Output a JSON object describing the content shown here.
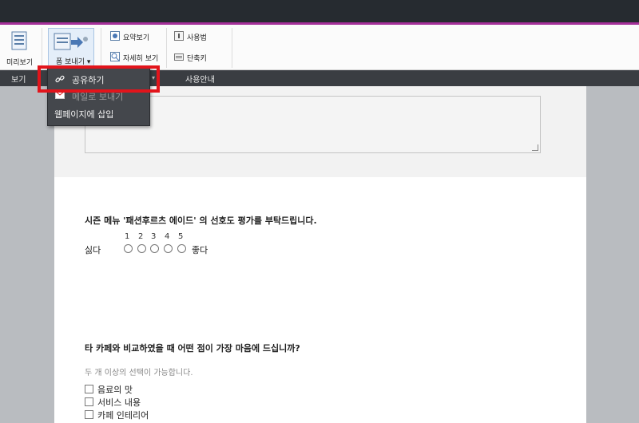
{
  "ribbon": {
    "preview_label": "미리보기",
    "send_form_label": "폼 보내기 ▾",
    "summary_view_label": "요약보기",
    "detail_view_label": "자세히 보기",
    "usage_label": "사용법",
    "shortcut_label": "단축키"
  },
  "groups": {
    "view": "보기",
    "guide": "사용안내"
  },
  "dropdown": {
    "share_label": "공유하기",
    "email_label": "메일로 보내기",
    "embed_label": "웹페이지에 삽입"
  },
  "survey": {
    "q1_title": "시즌 메뉴 '패션후르츠 에이드' 의 선호도 평가를 부탁드립니다.",
    "scale": [
      "1",
      "2",
      "3",
      "4",
      "5"
    ],
    "scale_low": "싫다",
    "scale_high": "좋다",
    "q2_title": "타 카페와 비교하였을 때 어떤 점이 가장 마음에 드십니까?",
    "q2_hint": "두 개 이상의 선택이 가능합니다.",
    "options": [
      "음료의 맛",
      "서비스 내용",
      "카페 인테리어"
    ]
  },
  "colors": {
    "accent": "#a5309a",
    "highlight": "#e2141b",
    "titlebar": "#262b30"
  }
}
